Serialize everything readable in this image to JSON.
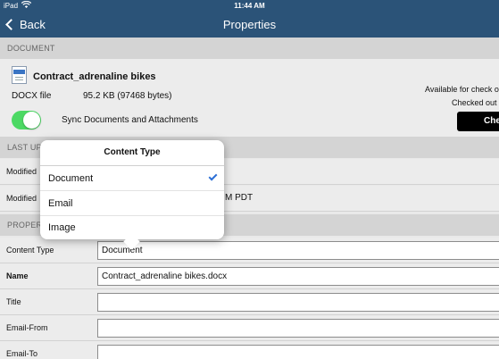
{
  "status": {
    "carrier": "iPad",
    "time": "11:44 AM"
  },
  "nav": {
    "back_label": "Back",
    "title": "Properties"
  },
  "sections": {
    "document": "DOCUMENT",
    "last_updated": "LAST UP",
    "properties": "PROPER"
  },
  "document": {
    "name": "Contract_adrenaline bikes",
    "type": "DOCX file",
    "size": "95.2 KB (97468 bytes)",
    "sync_label": "Sync Documents and Attachments",
    "sync_enabled": true,
    "availability": "Available for check o",
    "checked_out": "Checked out",
    "checkin_button": "Che"
  },
  "last_updated": {
    "rows": [
      {
        "label": "Modified",
        "value": ""
      },
      {
        "label": "Modified",
        "value": "M PDT"
      }
    ]
  },
  "popover": {
    "title": "Content Type",
    "options": [
      {
        "label": "Document",
        "selected": true
      },
      {
        "label": "Email",
        "selected": false
      },
      {
        "label": "Image",
        "selected": false
      }
    ]
  },
  "properties": {
    "content_type": {
      "label": "Content Type",
      "value": "Document"
    },
    "name": {
      "label": "Name",
      "value": "Contract_adrenaline bikes.docx"
    },
    "title": {
      "label": "Title",
      "value": ""
    },
    "email_from": {
      "label": "Email-From",
      "value": ""
    },
    "email_to": {
      "label": "Email-To",
      "value": ""
    }
  },
  "colors": {
    "nav_bar": "#2b5378",
    "toggle_on": "#4cd964",
    "checkmark": "#2c6fd6"
  },
  "icons": {
    "back": "chevron-left-icon",
    "wifi": "wifi-icon",
    "document": "docx-file-icon",
    "check": "checkmark-icon"
  }
}
